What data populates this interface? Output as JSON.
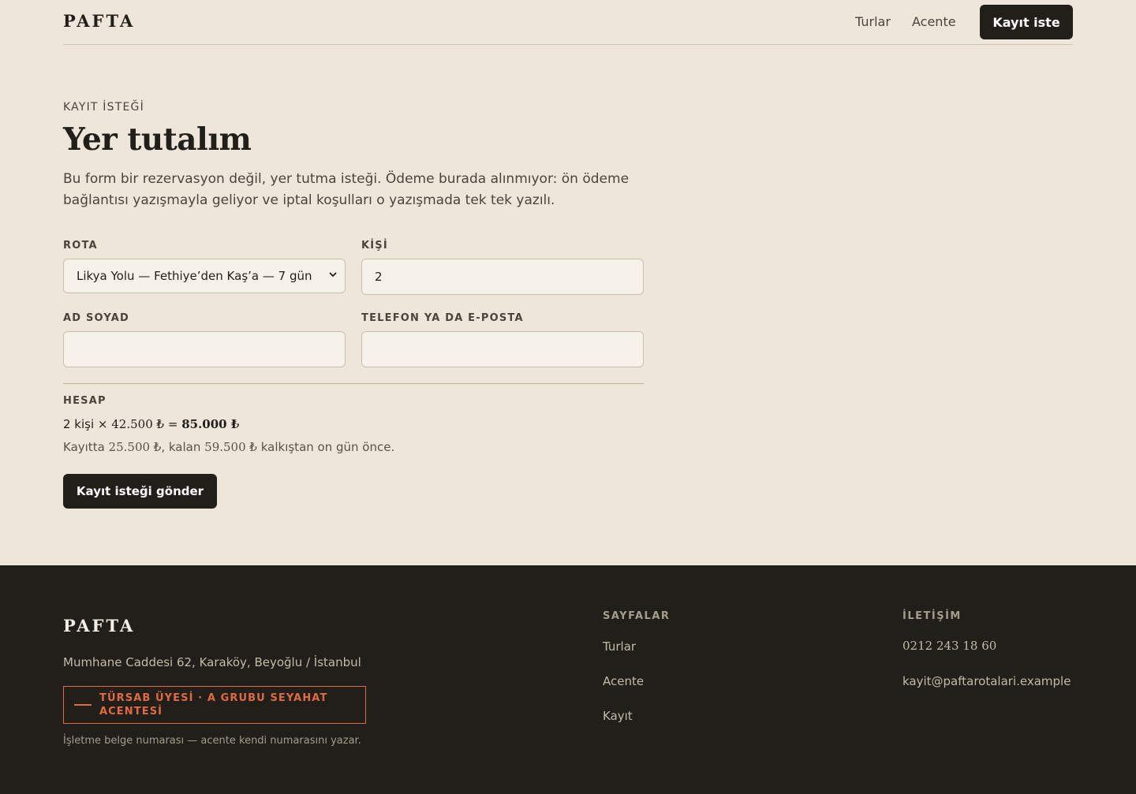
{
  "header": {
    "logo": "PAFTA",
    "nav": [
      "Turlar",
      "Acente"
    ],
    "cta_label": "Kayıt iste"
  },
  "main": {
    "eyebrow": "KAYIT İSTEĞİ",
    "title": "Yer tutalım",
    "intro": "Bu form bir rezervasyon değil, yer tutma isteği. Ödeme burada alınmıyor: ön ödeme bağlantısı yazışmayla geliyor ve iptal koşulları o yazışmada tek tek yazılı."
  },
  "form": {
    "route_label": "ROTA",
    "route_value": "Likya Yolu — Fethiye’den Kaş’a — 7 gün",
    "people_label": "KİŞİ",
    "people_value": "2",
    "name_label": "AD SOYAD",
    "name_value": "",
    "contact_label": "TELEFON YA DA E-POSTA",
    "contact_value": ""
  },
  "summary": {
    "label": "HESAP",
    "people_text": "2 kişi ×",
    "unit_price": "42.500 ₺",
    "equals": "=",
    "total": "85.000 ₺",
    "note_prefix": "Kayıtta",
    "deposit": "25.500 ₺",
    "note_middle": ", kalan",
    "remaining": "59.500 ₺",
    "note_suffix": "kalkıştan on gün önce.",
    "submit_label": "Kayıt isteği gönder"
  },
  "footer": {
    "logo": "PAFTA",
    "address": "Mumhane Caddesi 62, Karaköy, Beyoğlu / İstanbul",
    "badge_line1": "TÜRSAB ÜYESİ · A GRUBU SEYAHAT",
    "badge_line2": "ACENTESİ",
    "small_note": "İşletme belge numarası — acente kendi numarasını yazar.",
    "pages_heading": "SAYFALAR",
    "pages": [
      "Turlar",
      "Acente",
      "Kayıt"
    ],
    "contact_heading": "İLETİŞİM",
    "phone": "0212 243 18 60",
    "email": "kayit@paftarotalari.example"
  },
  "colors": {
    "background": "#eee6da",
    "ink": "#221f1b",
    "footer_bg": "#221f1b",
    "accent": "#e06a42",
    "field_bg": "#f6f2e9"
  },
  "icons": {
    "select_arrow": "chevron-down-icon",
    "badge_mark": "dash-icon"
  }
}
